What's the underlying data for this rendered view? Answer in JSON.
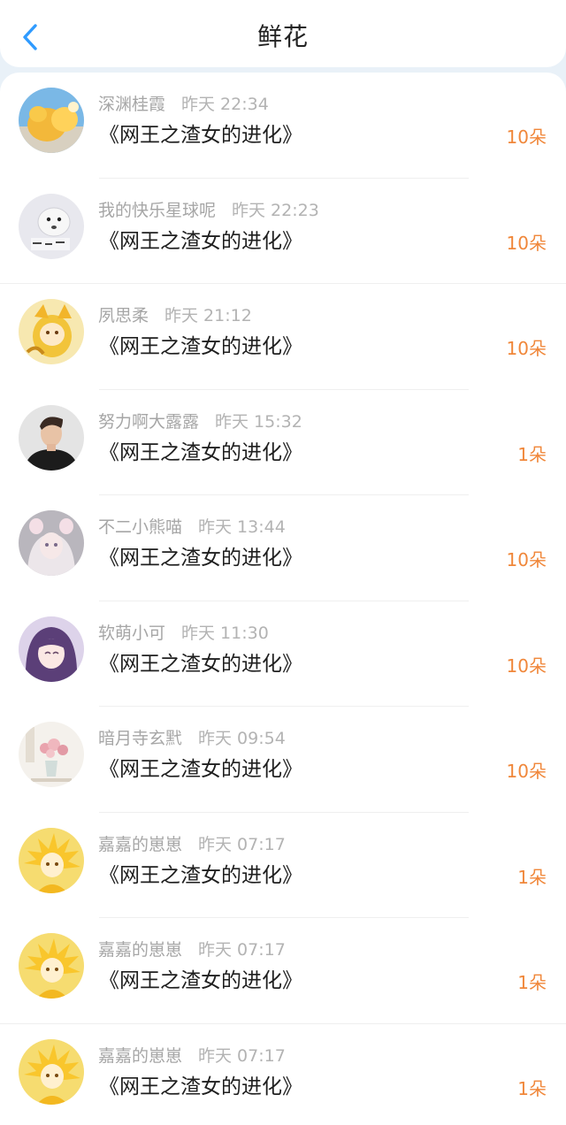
{
  "header": {
    "title": "鲜花"
  },
  "icons": {
    "back": "chevron-left-icon"
  },
  "colors": {
    "accent_blue": "#2f9bff",
    "flower_count": "#f0873a"
  },
  "entries": [
    {
      "user": "深渊桂霞",
      "time": "昨天 22:34",
      "book": "《网王之渣女的进化》",
      "count": "10朵"
    },
    {
      "user": "我的快乐星球呢",
      "time": "昨天 22:23",
      "book": "《网王之渣女的进化》",
      "count": "10朵"
    },
    {
      "user": "夙思柔",
      "time": "昨天 21:12",
      "book": "《网王之渣女的进化》",
      "count": "10朵"
    },
    {
      "user": "努力啊大露露",
      "time": "昨天 15:32",
      "book": "《网王之渣女的进化》",
      "count": "1朵"
    },
    {
      "user": "不二小熊喵",
      "time": "昨天 13:44",
      "book": "《网王之渣女的进化》",
      "count": "10朵"
    },
    {
      "user": "软萌小可",
      "time": "昨天 11:30",
      "book": "《网王之渣女的进化》",
      "count": "10朵"
    },
    {
      "user": "暗月寺玄黓",
      "time": "昨天 09:54",
      "book": "《网王之渣女的进化》",
      "count": "10朵"
    },
    {
      "user": "嘉嘉的崽崽",
      "time": "昨天 07:17",
      "book": "《网王之渣女的进化》",
      "count": "1朵"
    },
    {
      "user": "嘉嘉的崽崽",
      "time": "昨天 07:17",
      "book": "《网王之渣女的进化》",
      "count": "1朵"
    },
    {
      "user": "嘉嘉的崽崽",
      "time": "昨天 07:17",
      "book": "《网王之渣女的进化》",
      "count": "1朵"
    }
  ]
}
